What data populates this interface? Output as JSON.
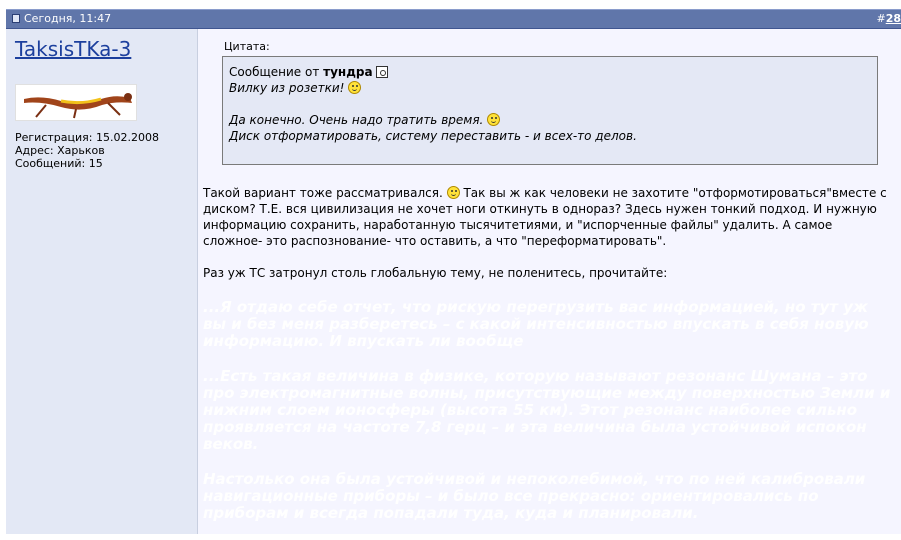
{
  "header": {
    "date": "Сегодня, 11:47",
    "post_number_prefix": "#",
    "post_number": "28"
  },
  "user": {
    "name": "TaksisTKa-3",
    "registration": "Регистрация: 15.02.2008",
    "address": "Адрес: Харьков",
    "messages": "Сообщений: 15"
  },
  "quote": {
    "label": "Цитата:",
    "from_prefix": "Сообщение от",
    "author": "тундра",
    "line1": "Вилку из розетки!",
    "line2": "Да конечно. Очень надо тратить время.",
    "line3": "Диск отформатировать, систему переставить - и всех-то делов."
  },
  "body": {
    "p1_a": "Такой вариант тоже рассматривался.",
    "p1_b": "Так вы ж как человеки не захотите \"отформотироваться\"вместе с диском? Т.Е. вся цивилизация не хочет ноги откинуть в однораз? Здесь нужен тонкий подход. И нужную информацию сохранить, наработанную тысячитетиями, и \"испорченные файлы\" удалить. А самое сложное- это распознование- что оставить, а что \"переформатировать\".",
    "p2": "Раз уж ТС затронул столь глобальную тему, не поленитесь, прочитайте:"
  },
  "hidden": {
    "p1": "...Я отдаю себе отчет, что рискую перегрузить вас информацией, но тут уж вы и без меня разберетесь – с какой интенсивностью впускать в себя новую информацию. И впускать ли вообще",
    "p2": "...Есть такая величина в физике, которую называют резонанс Шумана – это про электромагнитные волны, присутствующие между поверхностью Земли и нижним слоем ионосферы (высота 55 км). Этот резонанс наиболее сильно проявляется на частоте 7,8 герц – и эта величина была устойчивой испокон веков.",
    "p3": "Настолько она была устойчивой и непоколебимой, что по ней калибровали навигационные приборы – и было все прекрасно: ориентировались по приборам и всегда попадали туда, куда и планировали."
  }
}
